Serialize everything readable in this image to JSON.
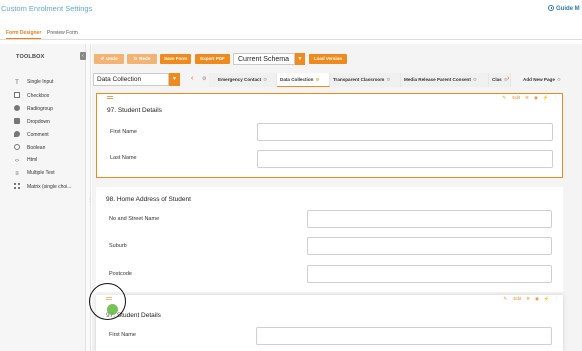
{
  "app": {
    "title": "Custom Enrolment Settings",
    "guide_label": "Guide M"
  },
  "mode_tabs": [
    {
      "label": "Form Designer",
      "active": true
    },
    {
      "label": "Preview Form",
      "active": false
    }
  ],
  "toolbox": {
    "title": "TOOLBOX",
    "collapse_icon": "chevron-left-icon",
    "items": [
      {
        "label": "Single Input",
        "icon": "text-icon"
      },
      {
        "label": "Checkbox",
        "icon": "checkbox-icon"
      },
      {
        "label": "Radiogroup",
        "icon": "radio-icon"
      },
      {
        "label": "Dropdown",
        "icon": "dropdown-icon"
      },
      {
        "label": "Comment",
        "icon": "comment-icon"
      },
      {
        "label": "Boolean",
        "icon": "toggle-icon"
      },
      {
        "label": "Html",
        "icon": "code-icon"
      },
      {
        "label": "Multiple Text",
        "icon": "multiple-text-icon"
      },
      {
        "label": "Matrix (single choi...",
        "icon": "grid-icon"
      }
    ]
  },
  "toolbar": {
    "undo": "Undo",
    "redo": "Redo",
    "save_form": "Save Form",
    "export_pdf": "Export PDF",
    "schema_value": "Current Schema",
    "load_version": "Load Version"
  },
  "pages": {
    "selected_page": "Data Collection",
    "tabs": [
      {
        "label": "Emergency Contact",
        "active": false
      },
      {
        "label": "Data Collection",
        "active": true
      },
      {
        "label": "Transparent Classroom",
        "active": false
      },
      {
        "label": "Media Release Parent Consent",
        "active": false
      },
      {
        "label": "Clas",
        "active": false
      }
    ],
    "add_new_page": "Add New Page"
  },
  "panel_actions": {
    "edit": "Edit"
  },
  "panels": [
    {
      "title": "97. Student Details",
      "questions": [
        "First Name",
        "Last Name"
      ]
    },
    {
      "title": "98. Home Address of Student",
      "questions": [
        "No and Street Name",
        "Suburb",
        "Postcode"
      ]
    },
    {
      "title": "97. Student Details",
      "questions": [
        "First Name"
      ]
    }
  ],
  "colors": {
    "accent": "#ef8a1e",
    "title_blue": "#5aa9d6"
  }
}
